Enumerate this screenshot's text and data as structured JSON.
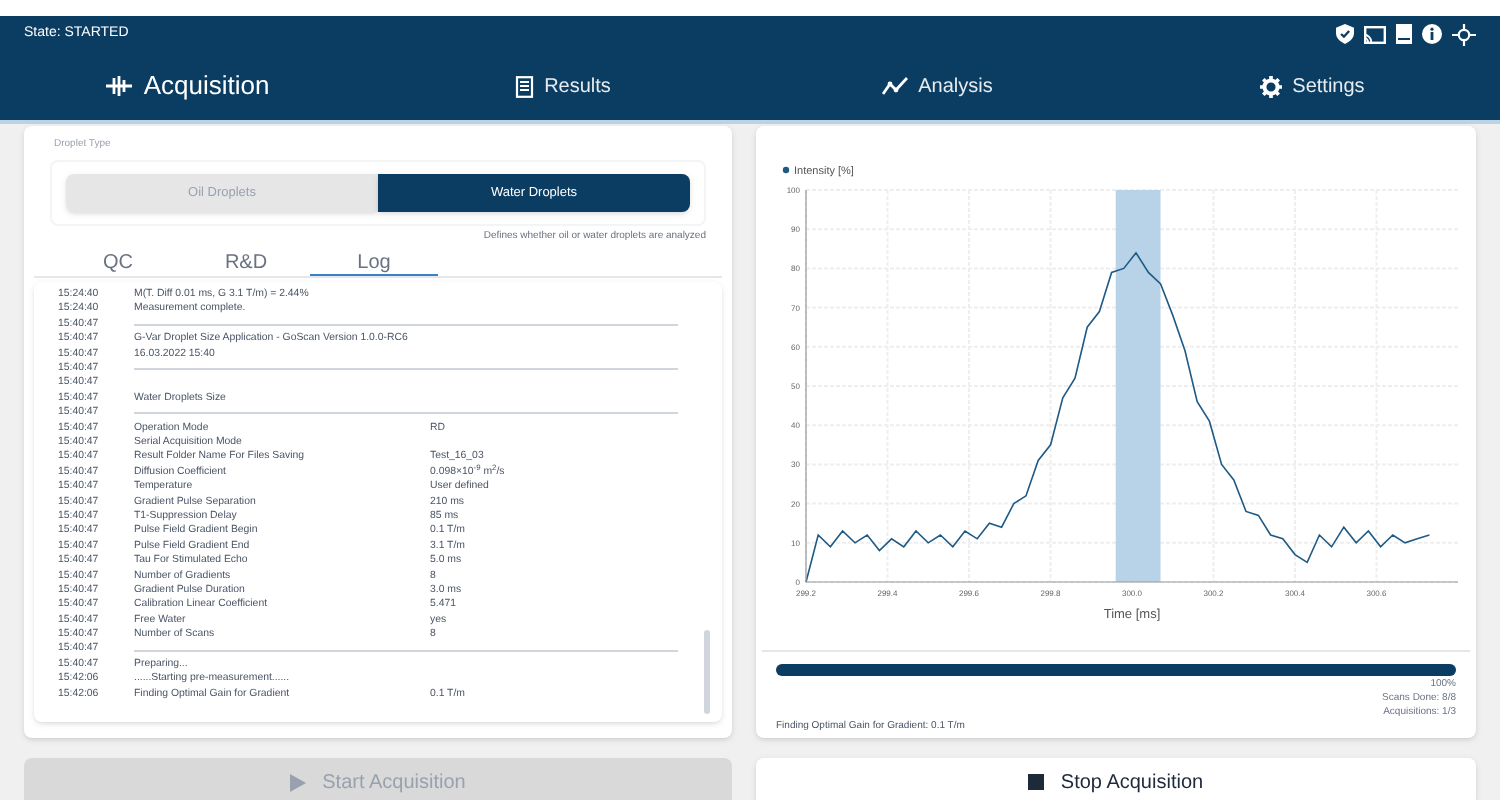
{
  "status": "State: STARTED",
  "nav": [
    {
      "label": "Acquisition",
      "kind": "acquisition",
      "selected": true
    },
    {
      "label": "Results",
      "kind": "results",
      "selected": false
    },
    {
      "label": "Analysis",
      "kind": "analysis",
      "selected": false
    },
    {
      "label": "Settings",
      "kind": "settings",
      "selected": false
    }
  ],
  "droplet_type": {
    "label": "Droplet Type",
    "options": [
      {
        "label": "Oil Droplets",
        "selected": false
      },
      {
        "label": "Water Droplets",
        "selected": true
      }
    ],
    "hint": "Defines whether oil or water droplets are analyzed"
  },
  "tabs": [
    {
      "label": "QC",
      "selected": false
    },
    {
      "label": "R&D",
      "selected": false
    },
    {
      "label": "Log",
      "selected": true
    }
  ],
  "log": [
    {
      "time": "15:24:40",
      "kind": "text",
      "text": "M(T. Diff 0.01 ms, G 3.1 T/m) = 2.44%"
    },
    {
      "time": "15:24:40",
      "kind": "text",
      "text": "Measurement complete."
    },
    {
      "time": "15:40:47",
      "kind": "rule"
    },
    {
      "time": "15:40:47",
      "kind": "text",
      "text": "G-Var Droplet Size Application - GoScan Version 1.0.0-RC6"
    },
    {
      "time": "15:40:47",
      "kind": "text",
      "text": "16.03.2022 15:40"
    },
    {
      "time": "15:40:47",
      "kind": "rule"
    },
    {
      "time": "15:40:47",
      "kind": "blank"
    },
    {
      "time": "15:40:47",
      "kind": "text",
      "text": "Water Droplets Size"
    },
    {
      "time": "15:40:47",
      "kind": "rule"
    },
    {
      "time": "15:40:47",
      "kind": "text",
      "text": "Operation Mode",
      "value": "RD"
    },
    {
      "time": "15:40:47",
      "kind": "text",
      "text": "Serial Acquisition Mode"
    },
    {
      "time": "15:40:47",
      "kind": "text",
      "text": "Result Folder Name For Files Saving",
      "value": "Test_16_03"
    },
    {
      "time": "15:40:47",
      "kind": "text",
      "text": "Diffusion Coefficient",
      "value": "0.098×10$^{-9}$ m$^{2}$/s"
    },
    {
      "time": "15:40:47",
      "kind": "text",
      "text": "Temperature",
      "value": "User defined"
    },
    {
      "time": "15:40:47",
      "kind": "text",
      "text": "Gradient Pulse Separation",
      "value": "210 ms"
    },
    {
      "time": "15:40:47",
      "kind": "text",
      "text": "T1-Suppression Delay",
      "value": "85 ms"
    },
    {
      "time": "15:40:47",
      "kind": "text",
      "text": "Pulse Field Gradient Begin",
      "value": "0.1 T/m"
    },
    {
      "time": "15:40:47",
      "kind": "text",
      "text": "Pulse Field Gradient End",
      "value": "3.1 T/m"
    },
    {
      "time": "15:40:47",
      "kind": "text",
      "text": "Tau For Stimulated Echo",
      "value": "5.0 ms"
    },
    {
      "time": "15:40:47",
      "kind": "text",
      "text": "Number of Gradients",
      "value": "8"
    },
    {
      "time": "15:40:47",
      "kind": "text",
      "text": "Gradient Pulse Duration",
      "value": "3.0 ms"
    },
    {
      "time": "15:40:47",
      "kind": "text",
      "text": "Calibration Linear Coefficient",
      "value": "5.471"
    },
    {
      "time": "15:40:47",
      "kind": "text",
      "text": "Free Water",
      "value": "yes"
    },
    {
      "time": "15:40:47",
      "kind": "text",
      "text": "Number of Scans",
      "value": "8"
    },
    {
      "time": "15:40:47",
      "kind": "rule"
    },
    {
      "time": "15:40:47",
      "kind": "text",
      "text": "Preparing..."
    },
    {
      "time": "15:42:06",
      "kind": "text",
      "text": "......Starting pre-measurement......"
    },
    {
      "time": "15:42:06",
      "kind": "text",
      "text": "Finding Optimal Gain for Gradient",
      "value": "0.1 T/m"
    }
  ],
  "chart_data": {
    "type": "line",
    "xlabel": "Time [ms]",
    "x": [
      299.2,
      299.23,
      299.26,
      299.29,
      299.32,
      299.35,
      299.38,
      299.41,
      299.44,
      299.47,
      299.5,
      299.53,
      299.56,
      299.59,
      299.62,
      299.65,
      299.68,
      299.71,
      299.74,
      299.77,
      299.8,
      299.83,
      299.86,
      299.89,
      299.92,
      299.95,
      299.98,
      300.01,
      300.04,
      300.07,
      300.1,
      300.13,
      300.16,
      300.19,
      300.22,
      300.25,
      300.28,
      300.31,
      300.34,
      300.37,
      300.4,
      300.43,
      300.46,
      300.49,
      300.52,
      300.55,
      300.58,
      300.61,
      300.64,
      300.67,
      300.7,
      300.73
    ],
    "series": [
      {
        "name": "Intensity [%]",
        "color": "#1f5a85",
        "values": [
          0,
          12,
          9,
          13,
          10,
          12,
          8,
          11,
          9,
          13,
          10,
          12,
          9,
          13,
          11,
          15,
          14,
          20,
          22,
          31,
          35,
          47,
          52,
          65,
          69,
          79,
          80,
          84,
          79,
          76,
          68,
          59,
          46,
          41,
          30,
          26,
          18,
          17,
          12,
          11,
          7,
          5,
          12,
          9,
          14,
          10,
          13,
          9,
          12,
          10,
          11,
          12
        ]
      }
    ],
    "xlim": [
      299.2,
      300.8
    ],
    "ylim": [
      0,
      100
    ],
    "xticks": [
      {
        "value": 299.2,
        "label": "299.2"
      },
      {
        "value": 299.4,
        "label": "299.4"
      },
      {
        "value": 299.6,
        "label": "299.6"
      },
      {
        "value": 299.8,
        "label": "299.8"
      },
      {
        "value": 300.0,
        "label": "300.0"
      },
      {
        "value": 300.2,
        "label": "300.2"
      },
      {
        "value": 300.4,
        "label": "300.4"
      },
      {
        "value": 300.6,
        "label": "300.6"
      }
    ],
    "yticks": [
      100,
      90,
      80,
      70,
      60,
      50,
      40,
      30,
      20,
      10,
      0
    ],
    "grid": true,
    "bands": [
      {
        "axis": "x",
        "from": 299.96,
        "to": 300.07,
        "color": "#b8d3e8"
      }
    ]
  },
  "progress": {
    "level": 1.0,
    "percent": "100%",
    "scans": "Scans Done: 8/8",
    "acquisitions": "Acquisitions: 1/3",
    "message": "Finding Optimal Gain for Gradient: 0.1 T/m"
  },
  "buttons": [
    {
      "label": "Start Acquisition",
      "kind": "start",
      "disabled": true
    },
    {
      "label": "Stop Acquisition",
      "kind": "stop",
      "disabled": false
    }
  ]
}
